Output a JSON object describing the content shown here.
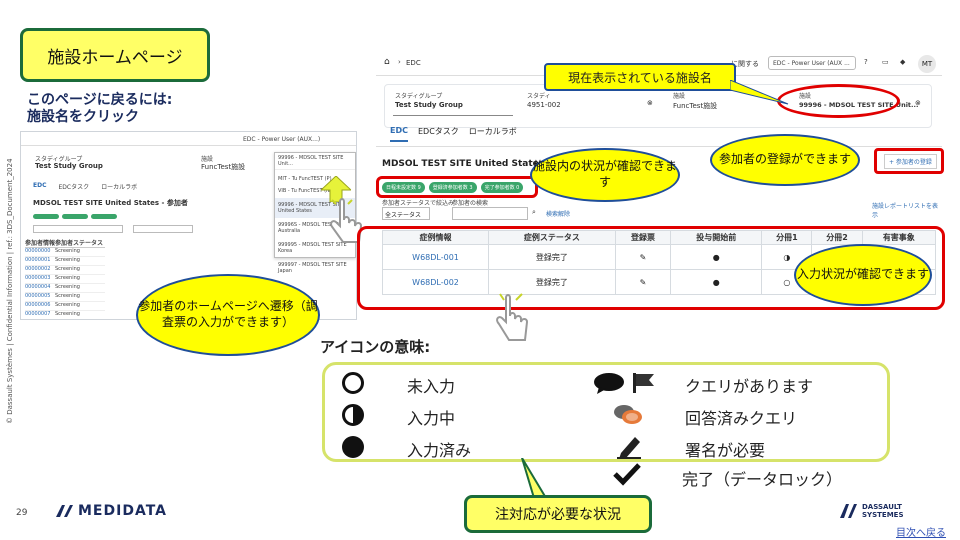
{
  "slide_title": "施設ホームページ",
  "return_note": {
    "line1": "このページに戻るには:",
    "line2": "施設名をクリック"
  },
  "left_shot": {
    "header": "EDC - Power User (AUX...)",
    "study_label": "スタディグループ",
    "study": "Test Study Group",
    "site_label": "施設",
    "site": "FuncTest施設",
    "tabs": [
      "EDC",
      "EDCタスク",
      "ローカルラボ"
    ],
    "page_title": "MDSOL TEST SITE United States - 参加者",
    "dropdown_items": [
      "99996 - MDSOL TEST SITE Unit...",
      "MIT - Tu FuncTEST (P)",
      "VIB - Tu FuncTEST (N)",
      "99996 - MDSOL TEST SITE United States",
      "99996S - MDSOL TEST SITE Australia",
      "999995 - MDSOL TEST SITE Korea",
      "999997 - MDSOL TEST SITE Japan"
    ],
    "col_headers": [
      "参加者情報",
      "参加者ステータス"
    ],
    "rows": [
      [
        "00000000",
        "Screening"
      ],
      [
        "00000001",
        "Screening"
      ],
      [
        "00000002",
        "Screening"
      ],
      [
        "00000003",
        "Screening"
      ],
      [
        "00000004",
        "Screening"
      ],
      [
        "00000005",
        "Screening"
      ],
      [
        "00000006",
        "Screening"
      ],
      [
        "00000007",
        "Screening"
      ]
    ]
  },
  "right_shot": {
    "breadcrumb": "EDC",
    "header_user": "EDC - Power User (AUX ...",
    "header_link": "に関する",
    "avatar": "MT",
    "study_label": "スタディグループ",
    "study": "Test Study Group",
    "study2_label": "スタディ",
    "study2": "4951-002",
    "site_label": "施設",
    "site": "FuncTest施設",
    "site2_label": "施設",
    "site2": "99996 - MDSOL TEST SITE Unit...",
    "tabs": [
      "EDC",
      "EDCタスク",
      "ローカルラボ"
    ],
    "page_title": "MDSOL TEST SITE United States - 参加者",
    "add_button": "+ 参加者の登録",
    "chips": [
      "日程未設定数 9",
      "登録済参加者数 3",
      "完了参加者数 0"
    ],
    "filter_label": "参加者ステータスで絞込み",
    "filter_value": "全ステータス",
    "search_label": "参加者の検索",
    "search_reset": "検索解除",
    "report_link": "施設レポートリストを表示",
    "columns": [
      "症例情報",
      "症例ステータス",
      "登録票",
      "投与開始前",
      "分冊1",
      "分冊2",
      "有害事象"
    ],
    "rows": [
      {
        "id": "W68DL-001",
        "status": "登録完了"
      },
      {
        "id": "W68DL-002",
        "status": "登録完了"
      }
    ]
  },
  "callouts": {
    "site_name": "現在表示されている施設名",
    "site_status": "施設内の状況が確認できます",
    "add_participant": "参加者の登録ができます",
    "input_status": "入力状況が確認できます",
    "participant_home": "参加者のホームページへ遷移（調査票の入力ができます）",
    "attention": "注対応が必要な状況"
  },
  "icons_title": "アイコンの意味:",
  "legend": {
    "not_entered": "未入力",
    "in_progress": "入力中",
    "entered": "入力済み",
    "query": "クエリがあります",
    "answered_query": "回答済みクエリ",
    "signature": "署名が必要",
    "complete": "完了（データロック）"
  },
  "copyright": "© Dassault Systèmes | Confidential Information | ref.: 3DS_Document_2024",
  "page_number": "29",
  "medidata_logo": "MEDIDATA",
  "ds_logo_line1": "DASSAULT",
  "ds_logo_line2": "SYSTEMES",
  "back_link": "目次へ戻る",
  "colors": {
    "yellow": "#ffff00",
    "red": "#e00000",
    "green_border": "#1b6b3a",
    "link": "#2f6db3"
  }
}
